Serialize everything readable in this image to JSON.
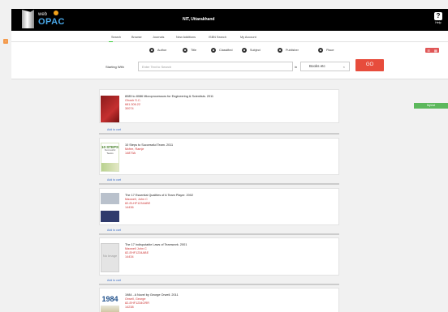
{
  "header": {
    "logo_top": "web",
    "logo_main": "OPAC",
    "institution": "NIT, Uttarakhand",
    "help_label": "Help"
  },
  "nav": {
    "items": [
      {
        "label": "Search"
      },
      {
        "label": "Browse"
      },
      {
        "label": "Journals"
      },
      {
        "label": "New Additions"
      },
      {
        "label": "ISBN Search"
      },
      {
        "label": "My Account"
      }
    ]
  },
  "search_by": {
    "options": [
      "Author",
      "Title",
      "Classified",
      "Subject",
      "Publisher",
      "Place"
    ],
    "selected": "Title"
  },
  "search": {
    "starting_with_label": "Starting With",
    "placeholder": "Enter Text to Search",
    "in_label": "in",
    "scope_value": "Books etc",
    "go_label": "GO"
  },
  "mylist_label": "MyList",
  "results": [
    {
      "title": "8085 to 8086 Microprocessors for Engineering & Scientists. 2011",
      "author": "Ghosh S.C.",
      "callno": "681.306.22",
      "acc": "30074",
      "add_label": "Add to cart",
      "cover": "book-cover-red"
    },
    {
      "title": "10 Steps to Successful Team. 2011",
      "author": "Mcfee, Ramje",
      "callno": "",
      "acc": "14879A",
      "add_label": "Add to cart",
      "cover_text_1": "10 STEPS",
      "cover_text_2": "Successful Teams"
    },
    {
      "title": "The 17 Essential Qualities of A Team Player. 2002",
      "author": "Maxwell, John C",
      "callno": "82-ELHF1234ABE",
      "acc": "14436",
      "add_label": "Add to cart"
    },
    {
      "title": "The 17 Indisputable Laws of Teamwork. 2001",
      "author": "Maxwell John C",
      "callno": "82-EHF1234ABE",
      "acc": "14434",
      "add_label": "Add to cart",
      "no_image_text": "No Image"
    },
    {
      "title": "1984 - A Novel by George Orwell. 2011",
      "author": "Orwell, George",
      "callno": "82-EHF1234ORR",
      "acc": "14238",
      "add_label": "",
      "cover_num": "1984"
    }
  ]
}
